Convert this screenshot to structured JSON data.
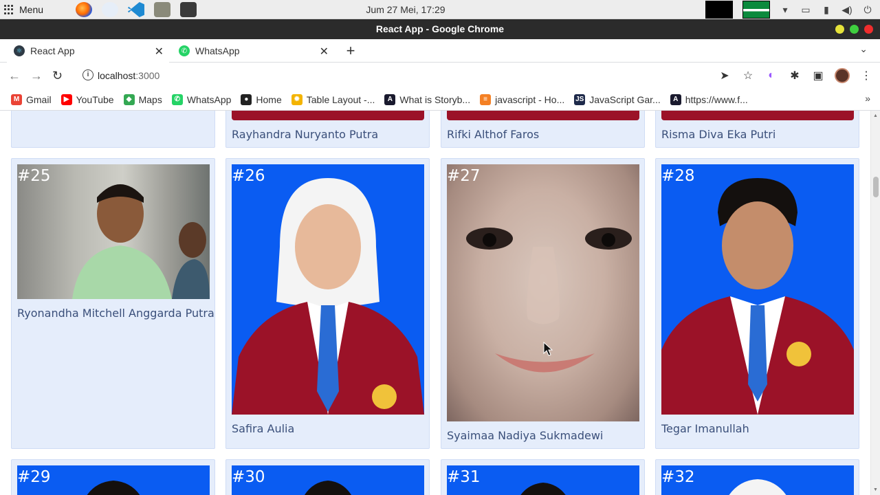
{
  "os": {
    "menu_label": "Menu",
    "clock": "Jum 27 Mei, 17:29"
  },
  "window": {
    "title": "React App - Google Chrome"
  },
  "tabs": [
    {
      "label": "React App",
      "active": true
    },
    {
      "label": "WhatsApp",
      "active": false
    }
  ],
  "toolbar": {
    "url_host": "localhost",
    "url_port": ":3000"
  },
  "bookmarks": [
    {
      "label": "Gmail",
      "icon": "gmail-icon",
      "color": "#ea4335",
      "glyph": "M"
    },
    {
      "label": "YouTube",
      "icon": "youtube-icon",
      "color": "#ff0000",
      "glyph": "▶"
    },
    {
      "label": "Maps",
      "icon": "maps-icon",
      "color": "#34a853",
      "glyph": "◆"
    },
    {
      "label": "WhatsApp",
      "icon": "whatsapp-icon",
      "color": "#25d366",
      "glyph": "✆"
    },
    {
      "label": "Home",
      "icon": "home-bookmark-icon",
      "color": "#222222",
      "glyph": "●"
    },
    {
      "label": "Table Layout -...",
      "icon": "sun-icon",
      "color": "#f4b400",
      "glyph": "✹"
    },
    {
      "label": "What is Storyb...",
      "icon": "storybook-icon",
      "color": "#1a1a2e",
      "glyph": "A"
    },
    {
      "label": "javascript - Ho...",
      "icon": "stackoverflow-icon",
      "color": "#f48024",
      "glyph": "≡"
    },
    {
      "label": "JavaScript Gar...",
      "icon": "js-icon",
      "color": "#1e2a4a",
      "glyph": "JS"
    },
    {
      "label": "https://www.f...",
      "icon": "link-icon",
      "color": "#1a1a2e",
      "glyph": "A"
    }
  ],
  "cards_top": [
    {
      "name": ""
    },
    {
      "name": "Rayhandra Nuryanto Putra"
    },
    {
      "name": "Rifki Althof Faros"
    },
    {
      "name": "Risma Diva Eka Putri"
    }
  ],
  "cards_mid": [
    {
      "num": "#25",
      "name": "Ryonandha Mitchell Anggarda Putra"
    },
    {
      "num": "#26",
      "name": "Safira Aulia"
    },
    {
      "num": "#27",
      "name": "Syaimaa Nadiya Sukmadewi"
    },
    {
      "num": "#28",
      "name": "Tegar Imanullah"
    }
  ],
  "cards_bottom": [
    {
      "num": "#29"
    },
    {
      "num": "#30"
    },
    {
      "num": "#31"
    },
    {
      "num": "#32"
    }
  ],
  "colors": {
    "card_bg": "#e5edfb",
    "photo_blue": "#0a5cf2",
    "jacket_red": "#9b1228",
    "name_text": "#3a4f7a"
  }
}
